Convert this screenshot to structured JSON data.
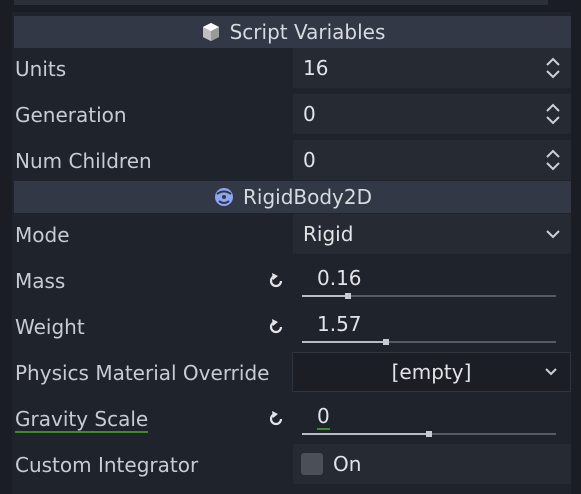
{
  "sections": {
    "script_variables": {
      "title": "Script Variables",
      "icon": "cube-icon"
    },
    "rigidbody": {
      "title": "RigidBody2D",
      "icon": "rigidbody2d-icon",
      "icon_color": "#8da5f3"
    }
  },
  "properties": {
    "units": {
      "label": "Units",
      "value": "16"
    },
    "generation": {
      "label": "Generation",
      "value": "0"
    },
    "num_children": {
      "label": "Num Children",
      "value": "0"
    },
    "mode": {
      "label": "Mode",
      "value": "Rigid"
    },
    "mass": {
      "label": "Mass",
      "value": "0.16",
      "slider_fraction": 0.18
    },
    "weight": {
      "label": "Weight",
      "value": "1.57",
      "slider_fraction": 0.33
    },
    "physics_material_override": {
      "label": "Physics Material Override",
      "value": "[empty]"
    },
    "gravity_scale": {
      "label": "Gravity Scale",
      "value": "0",
      "slider_fraction": 0.5,
      "modified_color": "#3f8a2a"
    },
    "custom_integrator": {
      "label": "Custom Integrator",
      "value": "On",
      "checked": false
    }
  },
  "colors": {
    "background": "#1f232b",
    "header": "#323846",
    "field": "#262a33",
    "text": "#cdd0d5"
  }
}
